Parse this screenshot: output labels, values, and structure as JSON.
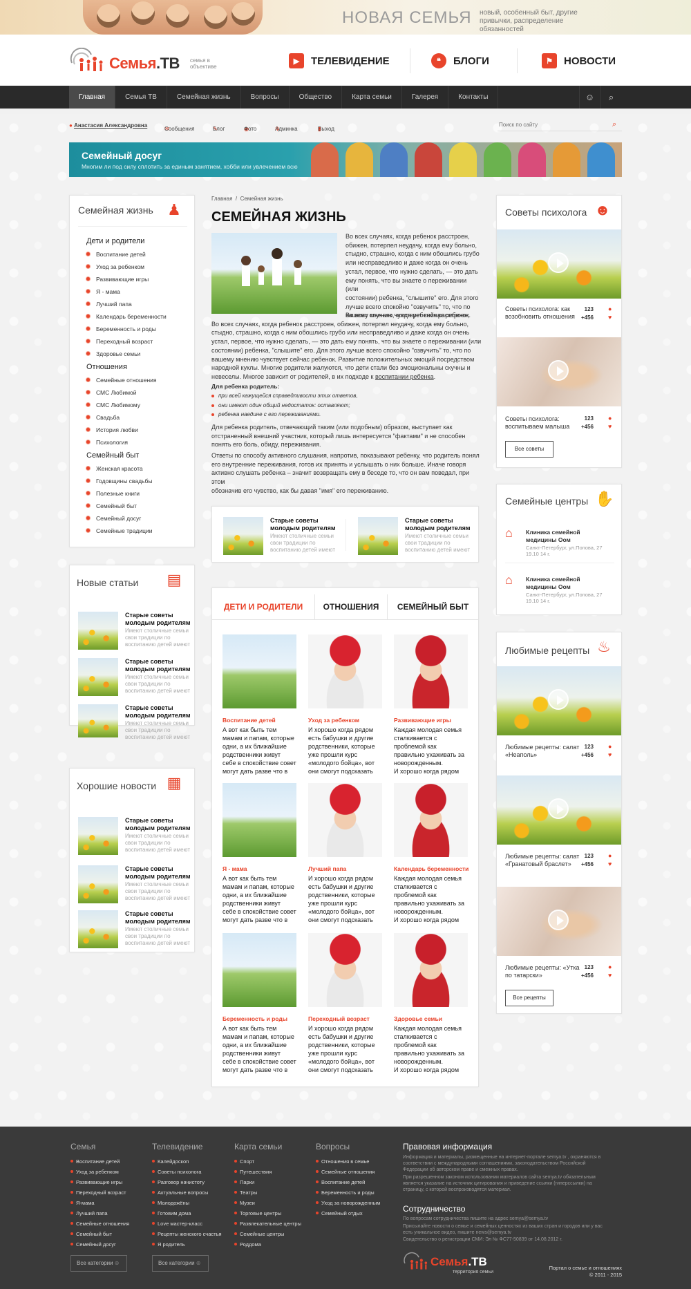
{
  "top_banner": {
    "title": "НОВАЯ СЕМЬЯ",
    "subtitle": "новый, особенный быт, другие привычки, распределение обязанностей"
  },
  "logo": {
    "name": "Семья",
    "tv": ".ТВ",
    "tagline": "семья в объективе"
  },
  "header_nav": [
    {
      "label": "ТЕЛЕВИДЕНИЕ",
      "icon": "tv-icon"
    },
    {
      "label": "БЛОГИ",
      "icon": "quote-icon"
    },
    {
      "label": "НОВОСТИ",
      "icon": "news-flag-icon"
    }
  ],
  "main_nav": [
    "Главная",
    "Семья ТВ",
    "Семейная жизнь",
    "Вопросы",
    "Общество",
    "Карта семьи",
    "Галерея",
    "Контакты"
  ],
  "userbar": {
    "user": "Анастасия Александровна",
    "messages": "Сообщения",
    "blog": "Блог",
    "photo": "Фото",
    "admin": "Админка",
    "logout": "Выход",
    "search_placeholder": "Поиск по сайту"
  },
  "family_banner": {
    "title": "Семейный досуг",
    "text": "Многим ли под силу сплотить за единым занятием, хобби или увлечением всю"
  },
  "left_menu": {
    "title": "Семейная жизнь",
    "groups": [
      {
        "title": "Дети и родители",
        "items": [
          "Воспитание детей",
          "Уход за ребенком",
          "Развивающие игры",
          "Я - мама",
          "Лучший папа",
          "Календарь беременности",
          "Беременность и роды",
          "Переходный возраст",
          "Здоровье семьи"
        ]
      },
      {
        "title": "Отношения",
        "items": [
          "Семейные отношения",
          "СМС Любимой",
          "СМС Любимому",
          "Свадьба",
          "История любви",
          "Психология"
        ]
      },
      {
        "title": "Семейный быт",
        "items": [
          "Женская красота",
          "Годовщины свадьбы",
          "Полезные книги",
          "Семейный быт",
          "Семейный досуг",
          "Семейные традиции"
        ]
      }
    ]
  },
  "new_articles": {
    "title": "Новые статьи",
    "items": [
      {
        "title": "Старые советы молодым родителям",
        "desc": "Имеют столичные семьи свои традиции по воспитанию детей имеют"
      },
      {
        "title": "Старые советы молодым родителям",
        "desc": "Имеют столичные семьи свои традиции по воспитанию детей имеют"
      },
      {
        "title": "Старые советы молодым родителям",
        "desc": "Имеют столичные семьи свои традиции по воспитанию детей имеют"
      }
    ]
  },
  "good_news": {
    "title": "Хорошие новости",
    "items": [
      {
        "title": "Старые советы молодым родителям",
        "desc": "Имеют столичные семьи свои традиции по воспитанию детей имеют"
      },
      {
        "title": "Старые советы молодым родителям",
        "desc": "Имеют столичные семьи свои традиции по воспитанию детей имеют"
      },
      {
        "title": "Старые советы молодым родителям",
        "desc": "Имеют столичные семьи свои традиции по воспитанию детей имеют"
      }
    ]
  },
  "breadcrumb": [
    "Главная",
    "Семейная жизнь"
  ],
  "article": {
    "title": "СЕМЕЙНАЯ ЖИЗНЬ",
    "lines_right": [
      "Во всех случаях, когда ребенок расстроен,",
      "обижен, потерпел неудачу, когда ему больно,",
      "стыдно, страшно, когда с ним обошлись грубо",
      "или несправедливо и даже когда он очень",
      "устал, первое, что нужно сделать, — это дать",
      "ему понять, что вы знаете о переживании (или",
      "состоянии) ребенка, \"слышите\" его. Для этого",
      "лучше всего спокойно \"озвучить\" то, что по",
      "вашему мнению чувствует сейчас ребенок."
    ],
    "lines_full": [
      "Во всех случаях, когда ребенок расстроен,",
      "Во всех случаях, когда ребенок расстроен, обижен, потерпел неудачу, когда ему больно,",
      "стыдно, страшно, когда с ним обошлись грубо или несправедливо и даже когда он очень",
      "устал, первое, что нужно сделать, — это дать ему понять, что вы знаете о переживании (или",
      "состоянии) ребенка, \"слышите\" его. Для этого лучше всего спокойно \"озвучить\" то, что по",
      "вашему мнению чувствует сейчас ребенок. Развитие положительных эмоций посредством",
      "народной куклы. Многие родители жалуются, что дети стали без эмоциональны скучны и",
      "невеселы. Многое зависит от родителей, в их подходе к"
    ],
    "link": "воспитании ребенка",
    "list_title": "Для ребенка родитель:",
    "list": [
      "при всей кажущейся справедливости этих ответов,",
      "они имеют один общий недостаток: оставляют;",
      "ребенка наедине с его переживаниями."
    ],
    "para2": [
      "Для ребенка родитель, отвечающий таким (или подобным) образом, выступает как",
      "отстраненный внешний участник, который лишь интересуется \"фактами\" и не способен",
      "понять его боль, обиду, переживания."
    ],
    "para3": [
      "Ответы по способу активного слушания, напротив, показывают ребенку, что родитель понял",
      "его внутренние переживания, готов их принять и услышать о них больше. Иначе говоря",
      "активно слушать ребенка – значит возвращать ему в беседе то, что он вам поведал, при этом",
      "обозначив его чувство, как бы давая \"имя\" его переживанию."
    ]
  },
  "related": [
    {
      "title": "Старые советы молодым родителям",
      "desc": "Имеют столичные семьи свои традиции по воспитанию детей имеют"
    },
    {
      "title": "Старые советы молодым родителям",
      "desc": "Имеют столичные семьи свои традиции по воспитанию детей имеют"
    }
  ],
  "tabs": [
    "ДЕТИ И РОДИТЕЛИ",
    "ОТНОШЕНИЯ",
    "СЕМЕЙНЫЙ БЫТ"
  ],
  "grid": [
    {
      "label": "Воспитание детей",
      "text": [
        "А вот как быть тем",
        "мамам и папам, которые",
        "одни, а их ближайшие",
        "родственники живут",
        "себе в спокойствие совет",
        "могут дать разве что в"
      ]
    },
    {
      "label": "Уход за ребенком",
      "text": [
        "И хорошо когда рядом",
        "есть бабушки и другие",
        "родственники, которые",
        "уже прошли курс",
        "«молодого бойца», вот",
        "они смогут подсказать"
      ]
    },
    {
      "label": "Развивающие игры",
      "text": [
        "Каждая молодая семья",
        "сталкивается с",
        "проблемой как",
        "правильно ухаживать за",
        "новорожденным.",
        "И хорошо когда рядом"
      ]
    },
    {
      "label": "Я - мама",
      "text": [
        "А вот как быть тем",
        "мамам и папам, которые",
        "одни, а их ближайшие",
        "родственники живут",
        "себе в спокойствие совет",
        "могут дать разве что в"
      ]
    },
    {
      "label": "Лучший папа",
      "text": [
        "И хорошо когда рядом",
        "есть бабушки и другие",
        "родственники, которые",
        "уже прошли курс",
        "«молодого бойца», вот",
        "они смогут подсказать"
      ]
    },
    {
      "label": "Календарь беременности",
      "text": [
        "Каждая молодая семья",
        "сталкивается с",
        "проблемой как",
        "правильно ухаживать за",
        "новорожденным.",
        "И хорошо когда рядом"
      ]
    },
    {
      "label": "Беременность и роды",
      "text": [
        "А вот как быть тем",
        "мамам и папам, которые",
        "одни, а их ближайшие",
        "родственники живут",
        "себе в спокойствие совет",
        "могут дать разве что в"
      ]
    },
    {
      "label": "Переходный возраст",
      "text": [
        "И хорошо когда рядом",
        "есть бабушки и другие",
        "родственники, которые",
        "уже прошли курс",
        "«молодого бойца», вот",
        "они смогут подсказать"
      ]
    },
    {
      "label": "Здоровье семьи",
      "text": [
        "Каждая молодая семья",
        "сталкивается с",
        "проблемой как",
        "правильно ухаживать за",
        "новорожденным.",
        "И хорошо когда рядом"
      ]
    }
  ],
  "psych": {
    "title": "Советы психолога",
    "items": [
      {
        "caption": "Советы психолога: как возобновить отношения",
        "views": "123",
        "likes": "+456"
      },
      {
        "caption": "Советы психолога: воспитываем малыша",
        "views": "123",
        "likes": "+456"
      }
    ],
    "button": "Все советы"
  },
  "centers": {
    "title": "Семейные центры",
    "items": [
      {
        "name": "Клиника семейной медицины Оом",
        "address": "Санкт-Петербург, ул.Попова, 27",
        "hours": "19.10 14 г."
      },
      {
        "name": "Клиника семейной медицины Оом",
        "address": "Санкт-Петербург, ул.Попова, 27",
        "hours": "19.10 14 г."
      }
    ]
  },
  "recipes": {
    "title": "Любимые рецепты",
    "items": [
      {
        "caption": "Любимые рецепты: салат «Неаполь»",
        "views": "123",
        "likes": "+456"
      },
      {
        "caption": "Любимые рецепты: салат «Гранатовый браслет»",
        "views": "123",
        "likes": "+456"
      },
      {
        "caption": "Любимые рецепты: «Утка по татарски»",
        "views": "123",
        "likes": "+456"
      }
    ],
    "button": "Все рецепты"
  },
  "footer": {
    "cols": [
      {
        "title": "Семья",
        "items": [
          "Воспитание детей",
          "Уход за ребенком",
          "Развивающие игры",
          "Переходный возраст",
          "Я-мама",
          "Лучший папа",
          "Семейные отношения",
          "Семейный быт",
          "Семейный досуг"
        ],
        "button": "Все категории"
      },
      {
        "title": "Телевидение",
        "items": [
          "Калейдоскоп",
          "Советы психолога",
          "Разговор начистоту",
          "Актуальные вопросы",
          "Молодожёны",
          "Готовим дома",
          "Love мастер-класс",
          "Рецепты женского счастья",
          "Я родитель"
        ],
        "button": "Все категории"
      },
      {
        "title": "Карта семьи",
        "items": [
          "Спорт",
          "Путешествия",
          "Парки",
          "Театры",
          "Музеи",
          "Торговые центры",
          "Развлекательные центры",
          "Семейные центры",
          "Роддома"
        ]
      },
      {
        "title": "Вопросы",
        "items": [
          "Отношения в семье",
          "Семейные отношения",
          "Воспитание детей",
          "Беременность и роды",
          "Уход за новорожденным",
          "Семейный отдых"
        ]
      }
    ],
    "legal_title": "Правовая информация",
    "legal": [
      "Информация и материалы, размещенные на интернет-портале semya.tv , охраняются в",
      "соответствии с международными соглашениями, законодательством Российской",
      "Федерации об авторском праве и смежных правах.",
      "При разрешенном законом использовании материалов сайта semya.tv обязательным",
      "является указание на источник цитирования и приведение ссылки (гиперссылки) на",
      "страницу, с которой воспроизводятся материал."
    ],
    "coop_title": "Сотрудничество",
    "coop": [
      "По вопросам сотрудничества пишите на адрес semya@semya.tv",
      "Присылайте новости о семье и семейных ценностях из ваших стран и городов или у вас",
      "есть уникальное видео, пишите news@semya.tv",
      "Свидетельство о регистрации СМИ: Эл № ФС77-50839 от 14.08.2012 г."
    ],
    "logo_tag": "территория семьи",
    "portal": "Портал о семье и отношениях",
    "copy": "© 2011 - 2015"
  },
  "colors": {
    "accent": "#e8442b",
    "dark_nav": "#2a2a2a",
    "footer": "#3a3a3a"
  }
}
